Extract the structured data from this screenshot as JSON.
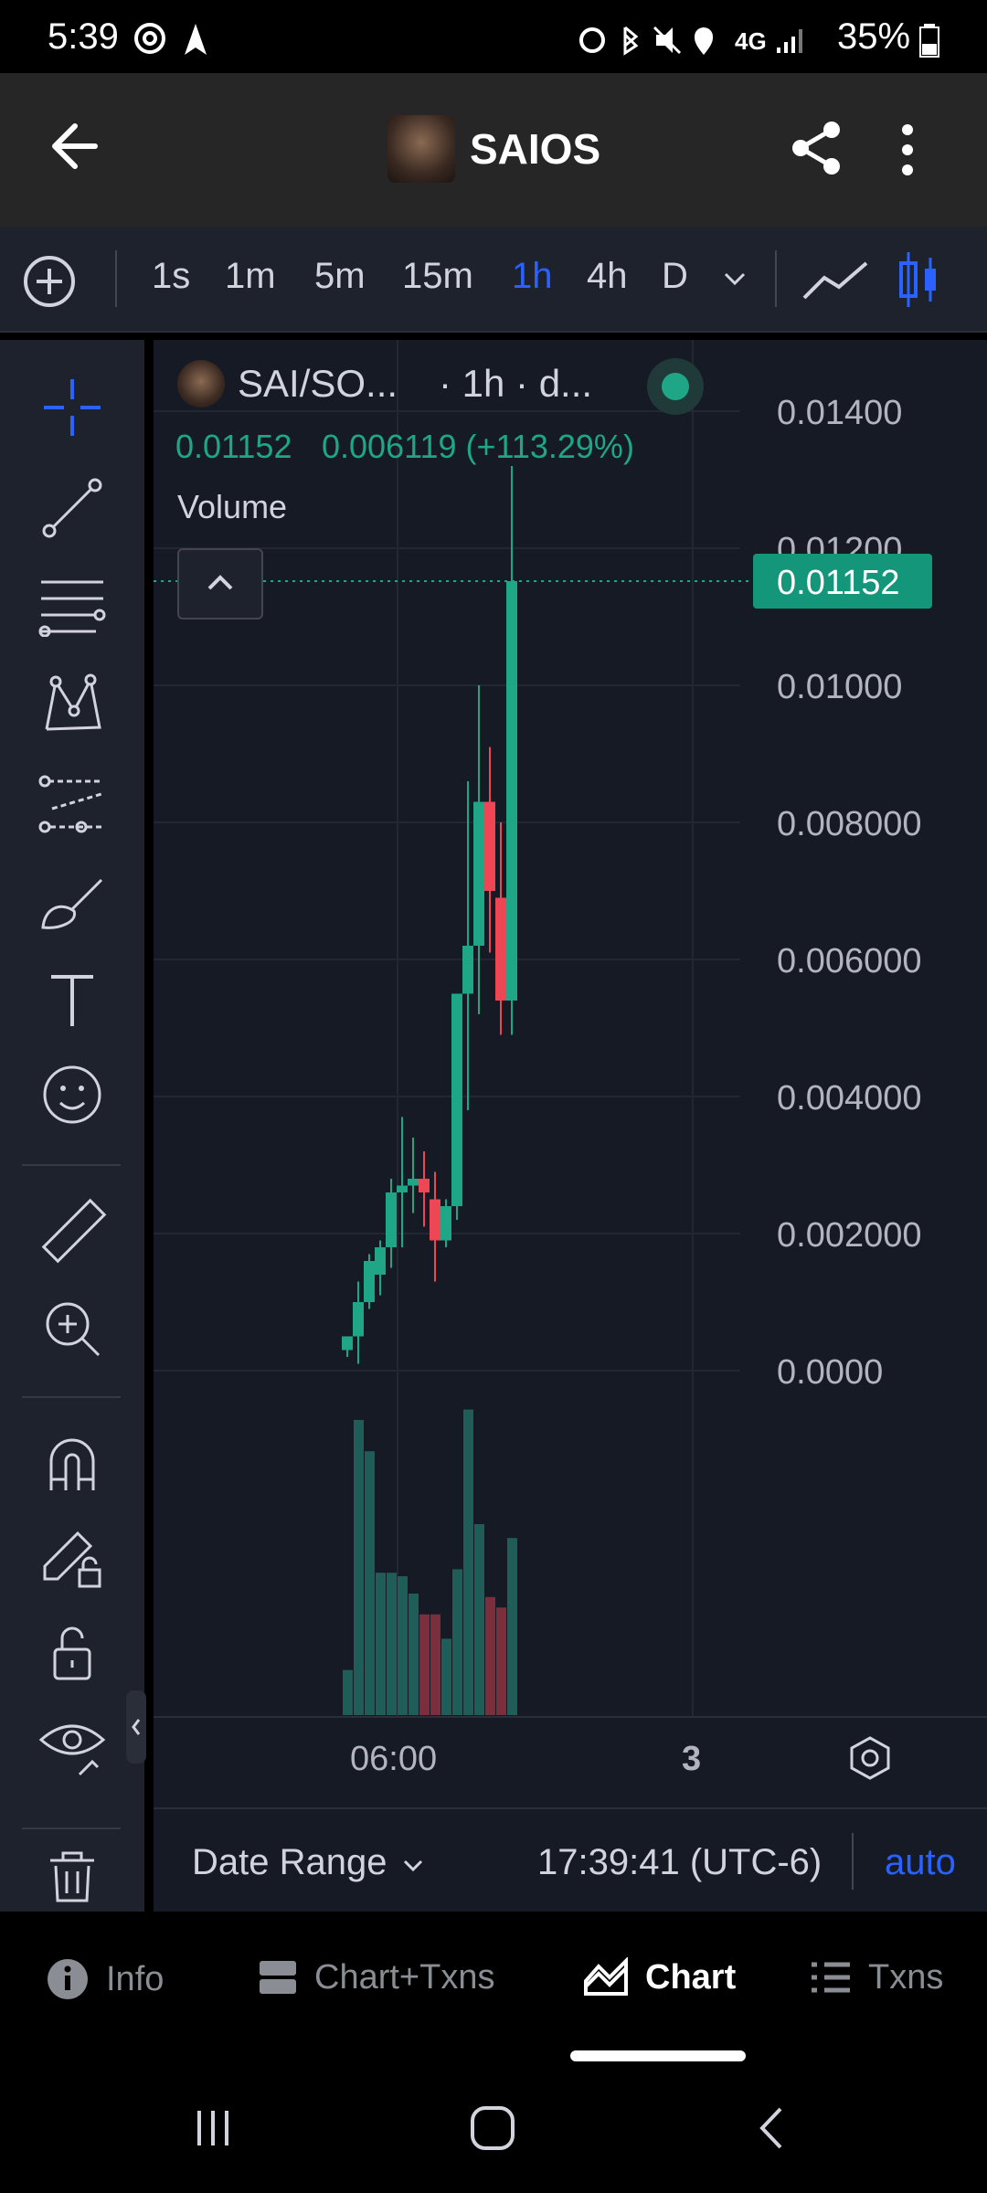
{
  "status_bar": {
    "time": "5:39",
    "network": "4G",
    "battery": "35%"
  },
  "header": {
    "title": "SAIOS"
  },
  "timeframes": [
    "1s",
    "1m",
    "5m",
    "15m",
    "1h",
    "4h",
    "D"
  ],
  "active_timeframe": "1h",
  "chart": {
    "symbol_label": "SAI/SO...",
    "interval_label": "· 1h · d...",
    "ohlc_close": "0.01152",
    "ohlc_change": "0.006119 (+113.29%)",
    "volume_label": "Volume",
    "last_price_label": "0.01152",
    "colors": {
      "up": "#1fa687",
      "down": "#ef4655",
      "vol_up": "#1f5e58",
      "vol_down": "#7b2e3b"
    }
  },
  "chart_data": {
    "type": "candlestick",
    "price_axis_ticks": [
      "0.01400",
      "0.01200",
      "0.01000",
      "0.008000",
      "0.006000",
      "0.004000",
      "0.002000",
      "0.0000"
    ],
    "time_axis_ticks": [
      "06:00",
      "3"
    ],
    "last_price": 0.01152,
    "candles": [
      {
        "o": 0.0003,
        "h": 0.0005,
        "l": 0.0002,
        "c": 0.0005
      },
      {
        "o": 0.0005,
        "h": 0.0013,
        "l": 0.0001,
        "c": 0.001
      },
      {
        "o": 0.001,
        "h": 0.0017,
        "l": 0.0009,
        "c": 0.0016
      },
      {
        "o": 0.0014,
        "h": 0.0019,
        "l": 0.0011,
        "c": 0.0018
      },
      {
        "o": 0.0018,
        "h": 0.0028,
        "l": 0.0015,
        "c": 0.0026
      },
      {
        "o": 0.0026,
        "h": 0.0037,
        "l": 0.0018,
        "c": 0.0027
      },
      {
        "o": 0.0027,
        "h": 0.0034,
        "l": 0.0023,
        "c": 0.0028
      },
      {
        "o": 0.0028,
        "h": 0.0032,
        "l": 0.0021,
        "c": 0.0026
      },
      {
        "o": 0.0025,
        "h": 0.0029,
        "l": 0.0013,
        "c": 0.0019
      },
      {
        "o": 0.0019,
        "h": 0.0025,
        "l": 0.0018,
        "c": 0.0024
      },
      {
        "o": 0.0024,
        "h": 0.003,
        "l": 0.0022,
        "c": 0.0055
      },
      {
        "o": 0.0055,
        "h": 0.0086,
        "l": 0.0038,
        "c": 0.0062
      },
      {
        "o": 0.0062,
        "h": 0.01,
        "l": 0.0052,
        "c": 0.0083
      },
      {
        "o": 0.0083,
        "h": 0.0091,
        "l": 0.0061,
        "c": 0.007
      },
      {
        "o": 0.0069,
        "h": 0.008,
        "l": 0.0049,
        "c": 0.0054
      },
      {
        "o": 0.0054,
        "h": 0.0132,
        "l": 0.0049,
        "c": 0.01152
      }
    ],
    "volume_levels": [
      0.13,
      0.85,
      0.76,
      0.41,
      0.41,
      0.4,
      0.35,
      0.29,
      0.29,
      0.22,
      0.42,
      0.88,
      0.55,
      0.34,
      0.31,
      0.51
    ]
  },
  "time_axis": {
    "label_1": "06:00",
    "label_2": "3"
  },
  "date_range": {
    "label": "Date Range",
    "time": "17:39:41 (UTC-6)",
    "mode": "auto"
  },
  "bottom_nav": [
    {
      "label": "Info",
      "icon": "info-icon"
    },
    {
      "label": "Chart+Txns",
      "icon": "split-icon"
    },
    {
      "label": "Chart",
      "icon": "chart-icon"
    },
    {
      "label": "Txns",
      "icon": "list-icon"
    }
  ]
}
